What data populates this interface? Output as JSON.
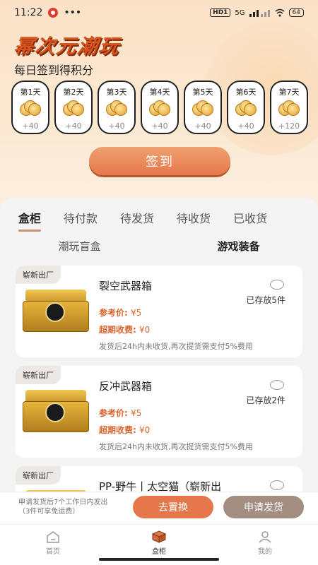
{
  "status_bar": {
    "time": "11:22",
    "dots": "•••",
    "hd": "HD1",
    "network": "5G",
    "battery": "64"
  },
  "hero": {
    "title": "幂次元潮玩",
    "subtitle": "每日签到得积分",
    "days": [
      {
        "label": "第1天",
        "points": "+40"
      },
      {
        "label": "第2天",
        "points": "+40"
      },
      {
        "label": "第3天",
        "points": "+40"
      },
      {
        "label": "第4天",
        "points": "+40"
      },
      {
        "label": "第5天",
        "points": "+40"
      },
      {
        "label": "第6天",
        "points": "+40"
      },
      {
        "label": "第7天",
        "points": "+120"
      }
    ],
    "signin_label": "签到"
  },
  "tabs": [
    "盒柜",
    "待付款",
    "待发货",
    "待收货",
    "已收货"
  ],
  "subtabs": [
    "潮玩盲盒",
    "游戏装备"
  ],
  "cards": [
    {
      "tag": "崭新出厂",
      "name": "裂空武器箱",
      "stored": "已存放5件",
      "price_label": "参考价: ",
      "price_value": "¥5",
      "fee_label": "超期收费: ",
      "fee_value": "¥0",
      "note": "发货后24h内未收货,再次提货需支付5%费用"
    },
    {
      "tag": "崭新出厂",
      "name": "反冲武器箱",
      "stored": "已存放2件",
      "price_label": "参考价: ",
      "price_value": "¥5",
      "fee_label": "超期收费: ",
      "fee_value": "¥0",
      "note": "发货后24h内未收货,再次提货需支付5%费用"
    },
    {
      "tag": "崭新出厂",
      "name": "PP-野牛丨太空猫（崭新出"
    }
  ],
  "action_bar": {
    "line1": "申请发货后7个工作日内发出",
    "line2": "（3件可享免运费）",
    "replace_label": "去置换",
    "ship_label": "申请发货"
  },
  "bottom_nav": [
    {
      "label": "首页",
      "icon": "home-icon"
    },
    {
      "label": "盒柜",
      "icon": "box-icon"
    },
    {
      "label": "我的",
      "icon": "user-icon"
    }
  ],
  "colors": {
    "accent": "#e5784a",
    "secondary_button": "#a48e81",
    "price": "#d9652e"
  }
}
